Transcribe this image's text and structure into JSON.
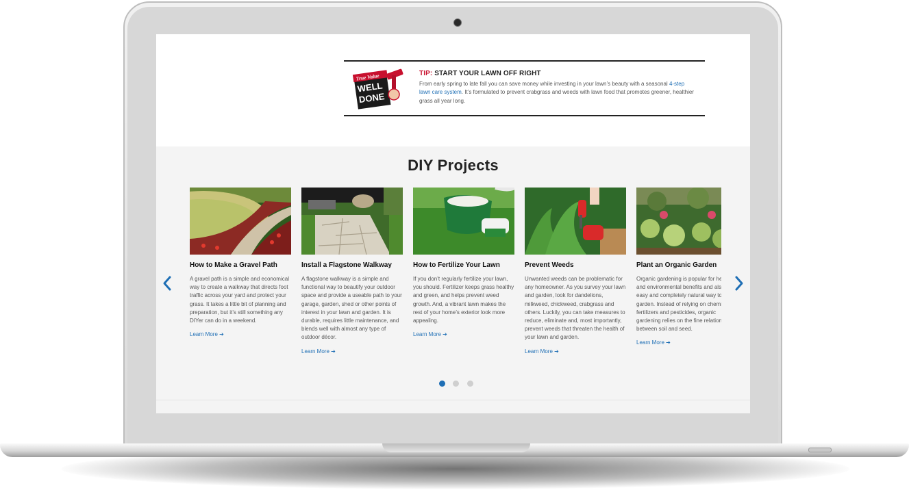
{
  "tip": {
    "label": "TIP:",
    "heading": "START YOUR LAWN OFF RIGHT",
    "body_before": "From early spring to late fall you can save money while investing in your lawn’s beauty with a seasonal ",
    "link_text": "4-step lawn care system",
    "body_after": ". It’s formulated to prevent crabgrass and weeds with lawn food that promotes greener, healthier grass all year long.",
    "badge": {
      "brand": "True Value",
      "line1": "WELL",
      "line2": "DONE"
    }
  },
  "section": {
    "title": "DIY Projects"
  },
  "cards": [
    {
      "title": "How to Make a Gravel Path",
      "text": "A gravel path is a simple and economical way to create a walkway that directs foot traffic across your yard and protect your grass. It takes a little bit of planning and preparation, but it’s still something any DIYer can do in a weekend.",
      "link": "Learn More ➔"
    },
    {
      "title": "Install a Flagstone Walkway",
      "text": "A flagstone walkway is a simple and functional way to beautify your outdoor space and provide a useable path to your garage, garden, shed or other points of interest in your lawn and garden. It is durable, requires little maintenance, and blends well with almost any type of outdoor décor.",
      "link": "Learn More ➔"
    },
    {
      "title": "How to Fertilize Your Lawn",
      "text": "If you don’t regularly fertilize your lawn, you should. Fertilizer keeps grass healthy and green, and helps prevent weed growth. And, a vibrant lawn makes the rest of your home’s exterior look more appealing.",
      "link": "Learn More ➔"
    },
    {
      "title": "Prevent Weeds",
      "text": "Unwanted weeds can be problematic for any homeowner. As you survey your lawn and garden, look for dandelions, milkweed, chickweed, crabgrass and others. Luckily, you can take measures to reduce, eliminate and, most importantly, prevent weeds that threaten the health of your lawn and garden.",
      "link": "Learn More ➔"
    },
    {
      "title": "Plant an Organic Garden",
      "text": "Organic gardening is popular for health and environmental benefits and also an easy and completely natural way to garden. Instead of relying on chemical fertilizers and pesticides, organic gardening relies on the fine relationship between soil and seed.",
      "link": "Learn More ➔"
    }
  ],
  "carousel": {
    "prev_icon": "chevron-left-icon",
    "next_icon": "chevron-right-icon",
    "page_count": 3,
    "active_page": 1
  },
  "colors": {
    "accent": "#1f6fb5",
    "tip_red": "#c8102e",
    "section_bg": "#f4f4f4"
  }
}
